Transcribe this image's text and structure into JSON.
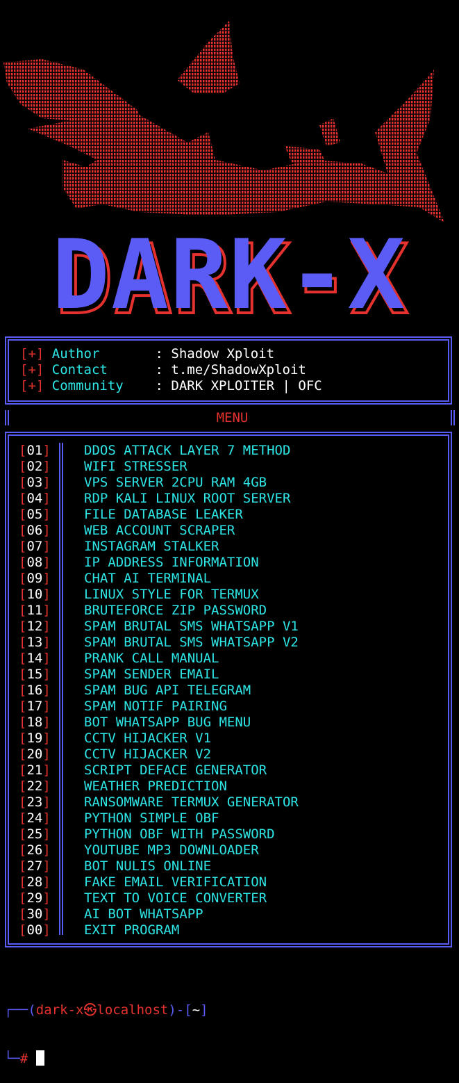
{
  "banner": {
    "logo_text": "DARK-X",
    "logo_color": "#5b5bf5",
    "shadow_color": "#e5322e",
    "art_color": "#e5322e"
  },
  "info": {
    "rows": [
      {
        "marker": "[+]",
        "key": "Author   ",
        "value": "Shadow Xploit"
      },
      {
        "marker": "[+]",
        "key": "Contact  ",
        "value": "t.me/ShadowXploit"
      },
      {
        "marker": "[+]",
        "key": "Community",
        "value": "DARK XPLOITER | OFC"
      }
    ],
    "colon": ":"
  },
  "menu_title": "MENU",
  "menu": {
    "items": [
      {
        "num": "01",
        "label": "DDOS ATTACK LAYER 7 METHOD"
      },
      {
        "num": "02",
        "label": "WIFI STRESSER"
      },
      {
        "num": "03",
        "label": "VPS SERVER 2CPU RAM 4GB"
      },
      {
        "num": "04",
        "label": "RDP KALI LINUX ROOT SERVER"
      },
      {
        "num": "05",
        "label": "FILE DATABASE LEAKER"
      },
      {
        "num": "06",
        "label": "WEB ACCOUNT SCRAPER"
      },
      {
        "num": "07",
        "label": "INSTAGRAM STALKER"
      },
      {
        "num": "08",
        "label": "IP ADDRESS INFORMATION"
      },
      {
        "num": "09",
        "label": "CHAT AI TERMINAL"
      },
      {
        "num": "10",
        "label": "LINUX STYLE FOR TERMUX"
      },
      {
        "num": "11",
        "label": "BRUTEFORCE ZIP PASSWORD"
      },
      {
        "num": "12",
        "label": "SPAM BRUTAL SMS WHATSAPP V1"
      },
      {
        "num": "13",
        "label": "SPAM BRUTAL SMS WHATSAPP V2"
      },
      {
        "num": "14",
        "label": "PRANK CALL MANUAL"
      },
      {
        "num": "15",
        "label": "SPAM SENDER EMAIL"
      },
      {
        "num": "16",
        "label": "SPAM BUG API TELEGRAM"
      },
      {
        "num": "17",
        "label": "SPAM NOTIF PAIRING"
      },
      {
        "num": "18",
        "label": "BOT WHATSAPP BUG MENU"
      },
      {
        "num": "19",
        "label": "CCTV HIJACKER V1"
      },
      {
        "num": "20",
        "label": "CCTV HIJACKER V2"
      },
      {
        "num": "21",
        "label": "SCRIPT DEFACE GENERATOR"
      },
      {
        "num": "22",
        "label": "WEATHER PREDICTION"
      },
      {
        "num": "23",
        "label": "RANSOMWARE TERMUX GENERATOR"
      },
      {
        "num": "24",
        "label": "PYTHON SIMPLE OBF"
      },
      {
        "num": "25",
        "label": "PYTHON OBF WITH PASSWORD"
      },
      {
        "num": "26",
        "label": "YOUTUBE MP3 DOWNLOADER"
      },
      {
        "num": "27",
        "label": "BOT NULIS ONLINE"
      },
      {
        "num": "28",
        "label": "FAKE EMAIL VERIFICATION"
      },
      {
        "num": "29",
        "label": "TEXT TO VOICE CONVERTER"
      },
      {
        "num": "30",
        "label": "AI BOT WHATSAPP"
      },
      {
        "num": "00",
        "label": "EXIT PROGRAM"
      }
    ]
  },
  "prompt": {
    "line1_prefix": "┌──(",
    "user_host": "dark-x㉿localhost",
    "line1_mid": ")-[",
    "cwd": "~",
    "line1_end": "]",
    "line2_prefix": "└─",
    "symbol": "#"
  }
}
